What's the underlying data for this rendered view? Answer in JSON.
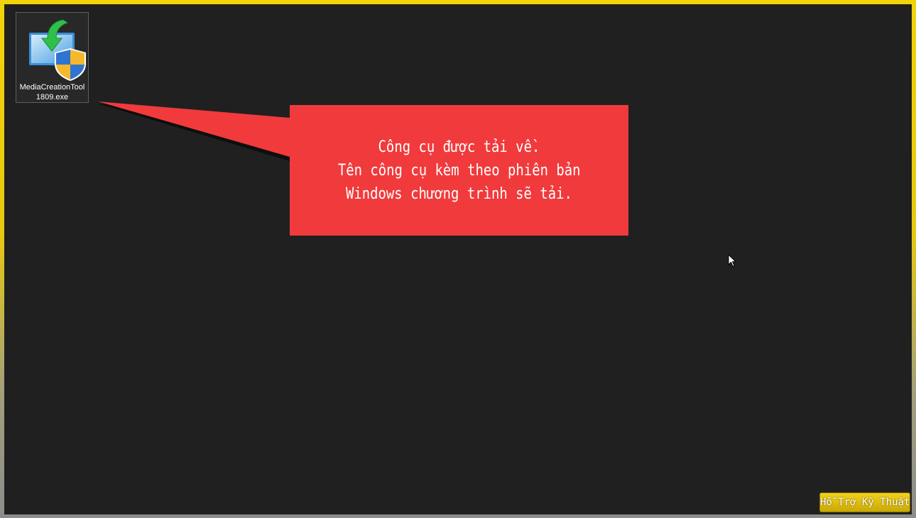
{
  "desktop": {
    "icons": [
      {
        "label": "MediaCreationTool1809.exe",
        "icon": "media-creation-tool-icon"
      }
    ]
  },
  "callout": {
    "lines": [
      "Công cụ được tải về.",
      "Tên công cụ kèm theo phiên bản",
      "Windows chương trình sẽ tải."
    ],
    "color": "#f13a3c"
  },
  "badge": {
    "label": "Hỗ Trợ Kỹ Thuật",
    "color": "#e8c810"
  },
  "colors": {
    "frame": "#f2d20a",
    "desktop_background": "#202020"
  }
}
